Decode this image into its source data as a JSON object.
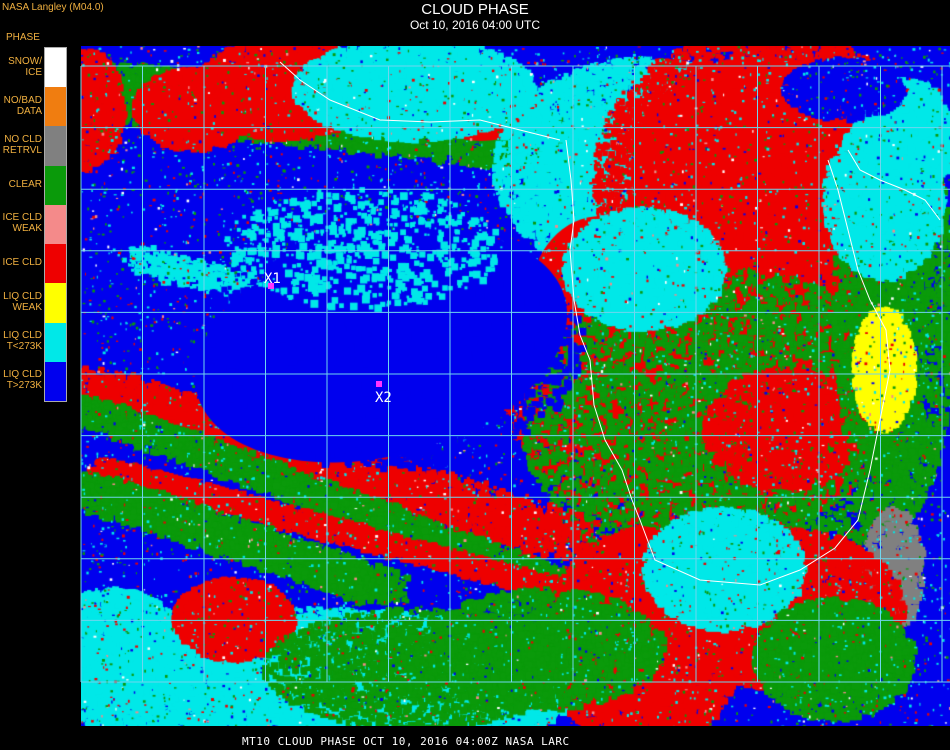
{
  "header": {
    "agency": "NASA Langley (M04.0)",
    "title": "CLOUD PHASE",
    "subtitle": "Oct 10, 2016 04:00 UTC"
  },
  "legend": {
    "title": "PHASE",
    "items": [
      {
        "line1": "SNOW/",
        "line2": "ICE",
        "color": "#ffffff"
      },
      {
        "line1": "NO/BAD",
        "line2": "DATA",
        "color": "#f07d10"
      },
      {
        "line1": "NO CLD",
        "line2": "RETRVL",
        "color": "#808080"
      },
      {
        "line1": "CLEAR",
        "line2": "",
        "color": "#0a9a0a"
      },
      {
        "line1": "ICE CLD",
        "line2": "WEAK",
        "color": "#f48a8a"
      },
      {
        "line1": "ICE CLD",
        "line2": "",
        "color": "#ee0000"
      },
      {
        "line1": "LIQ CLD",
        "line2": "WEAK",
        "color": "#ffff00"
      },
      {
        "line1": "LIQ CLD",
        "line2": "T<273K",
        "color": "#00e8e8"
      },
      {
        "line1": "LIQ CLD",
        "line2": "T>273K",
        "color": "#0000ee"
      }
    ]
  },
  "markers": [
    {
      "label": "X1"
    },
    {
      "label": "X2"
    }
  ],
  "map_colors": {
    "grid": "#6fd6ee",
    "coast": "#ffffff",
    "marker": "#ff33ff",
    "marker_text": "#ffffff",
    "background": "#000000"
  },
  "footer": {
    "text": "MT10  CLOUD PHASE   OCT 10, 2016 04:00Z   NASA LARC"
  }
}
